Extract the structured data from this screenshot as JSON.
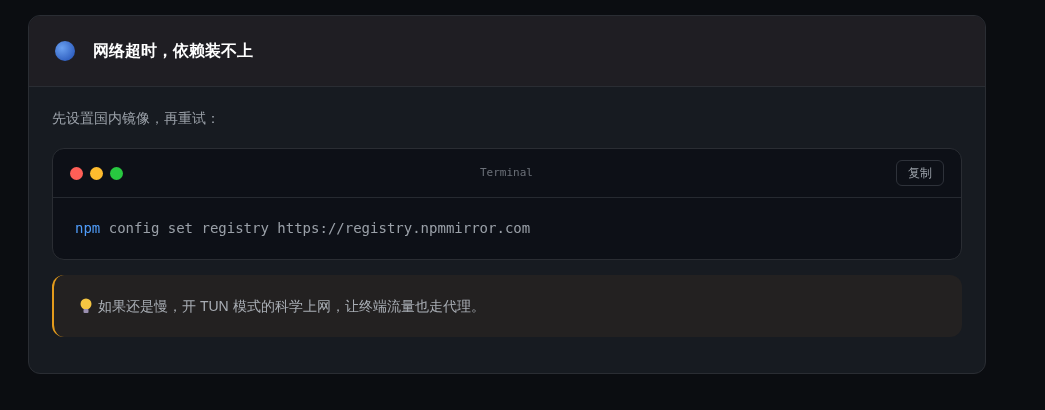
{
  "card": {
    "title": "网络超时，依赖装不上",
    "intro": "先设置国内镜像，再重试：",
    "terminal": {
      "title": "Terminal",
      "copy_button": "复制",
      "command": "npm",
      "arguments": "config set registry https://registry.npmmirror.com"
    },
    "tip": {
      "text": "如果还是慢，开 TUN 模式的科学上网，让终端流量也走代理。"
    }
  }
}
